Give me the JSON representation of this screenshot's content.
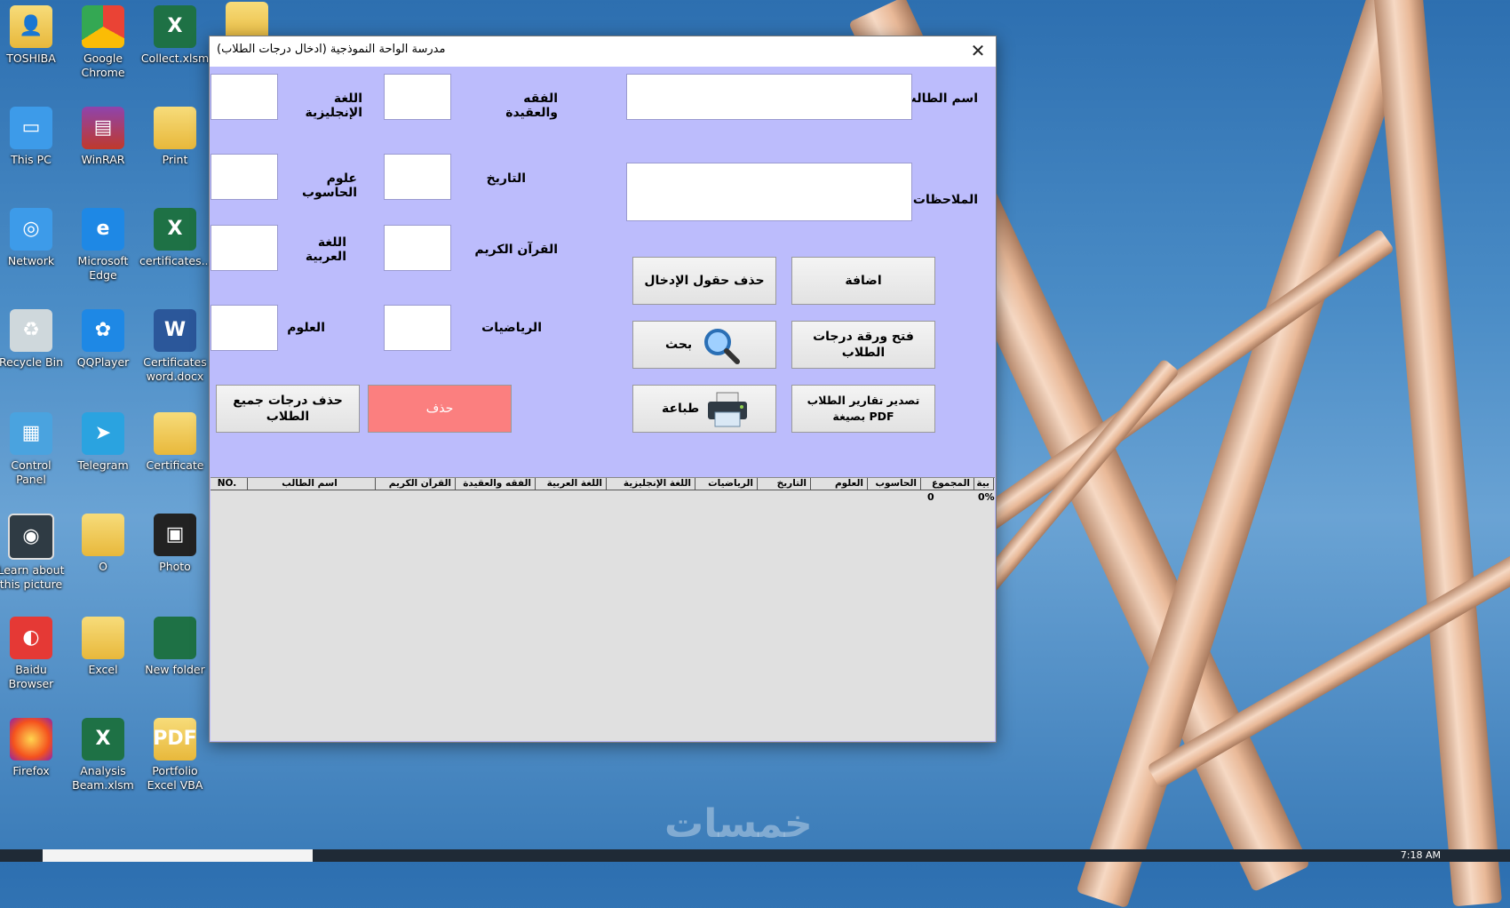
{
  "desktop": {
    "icons": [
      {
        "label": "TOSHIBA"
      },
      {
        "label": "Google Chrome"
      },
      {
        "label": "Collect.xlsm"
      },
      {
        "label": "This PC"
      },
      {
        "label": "WinRAR"
      },
      {
        "label": "Print"
      },
      {
        "label": "Network"
      },
      {
        "label": "Microsoft Edge"
      },
      {
        "label": "certificates...."
      },
      {
        "label": "Recycle Bin"
      },
      {
        "label": "QQPlayer"
      },
      {
        "label": "Certificates word.docx"
      },
      {
        "label": "Control Panel"
      },
      {
        "label": "Telegram"
      },
      {
        "label": "Certificate"
      },
      {
        "label": "Learn about this picture"
      },
      {
        "label": "O"
      },
      {
        "label": "Photo"
      },
      {
        "label": "Baidu Browser"
      },
      {
        "label": "Excel"
      },
      {
        "label": "New folder"
      },
      {
        "label": "Firefox"
      },
      {
        "label": "Analysis Beam.xlsm"
      },
      {
        "label": "Portfolio Excel VBA"
      }
    ],
    "watermark": "خمسات",
    "clock": "7:18 AM"
  },
  "dialog": {
    "title": "مدرسة الواحة النموذجية (ادخال درجات الطلاب)",
    "close": "✕",
    "fields": {
      "student_name": "اسم الطالب",
      "notes": "الملاحظات",
      "fiqh": "الفقه والعقيدة",
      "history": "التاريخ",
      "quran": "القرآن الكريم",
      "math": "الرياضيات",
      "english": "اللغة الإنجليزية",
      "computer": "علوم الحاسوب",
      "arabic": "اللغة العربية",
      "science": "العلوم"
    },
    "buttons": {
      "add": "اضافة",
      "clear": "حذف حقول الإدخال",
      "open_sheet": "فتح ورقة درجات الطلاب",
      "search": "بحث",
      "export_pdf": "تصدير تقارير الطلاب بصيغة PDF",
      "print": "طباعة",
      "delete": "حذف",
      "delete_all": "حذف درجات جميع الطلاب"
    },
    "table": {
      "headers": [
        "بية",
        "المجموع",
        "الحاسوب",
        "العلوم",
        "التاريخ",
        "الرياضيات",
        "اللغة الإنجليزية",
        "اللغة العربية",
        "الفقه والعقيدة",
        "القرآن الكريم",
        "اسم الطالب",
        "NO."
      ],
      "row": {
        "percent": "0%",
        "total": "0"
      }
    }
  }
}
